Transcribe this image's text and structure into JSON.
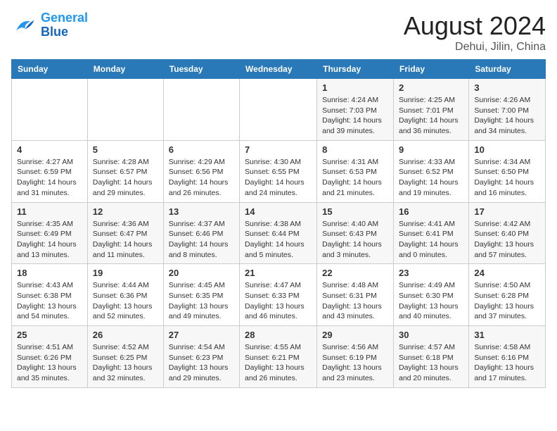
{
  "header": {
    "logo_line1": "General",
    "logo_line2": "Blue",
    "title": "August 2024",
    "location": "Dehui, Jilin, China"
  },
  "weekdays": [
    "Sunday",
    "Monday",
    "Tuesday",
    "Wednesday",
    "Thursday",
    "Friday",
    "Saturday"
  ],
  "weeks": [
    [
      {
        "day": "",
        "detail": ""
      },
      {
        "day": "",
        "detail": ""
      },
      {
        "day": "",
        "detail": ""
      },
      {
        "day": "",
        "detail": ""
      },
      {
        "day": "1",
        "detail": "Sunrise: 4:24 AM\nSunset: 7:03 PM\nDaylight: 14 hours\nand 39 minutes."
      },
      {
        "day": "2",
        "detail": "Sunrise: 4:25 AM\nSunset: 7:01 PM\nDaylight: 14 hours\nand 36 minutes."
      },
      {
        "day": "3",
        "detail": "Sunrise: 4:26 AM\nSunset: 7:00 PM\nDaylight: 14 hours\nand 34 minutes."
      }
    ],
    [
      {
        "day": "4",
        "detail": "Sunrise: 4:27 AM\nSunset: 6:59 PM\nDaylight: 14 hours\nand 31 minutes."
      },
      {
        "day": "5",
        "detail": "Sunrise: 4:28 AM\nSunset: 6:57 PM\nDaylight: 14 hours\nand 29 minutes."
      },
      {
        "day": "6",
        "detail": "Sunrise: 4:29 AM\nSunset: 6:56 PM\nDaylight: 14 hours\nand 26 minutes."
      },
      {
        "day": "7",
        "detail": "Sunrise: 4:30 AM\nSunset: 6:55 PM\nDaylight: 14 hours\nand 24 minutes."
      },
      {
        "day": "8",
        "detail": "Sunrise: 4:31 AM\nSunset: 6:53 PM\nDaylight: 14 hours\nand 21 minutes."
      },
      {
        "day": "9",
        "detail": "Sunrise: 4:33 AM\nSunset: 6:52 PM\nDaylight: 14 hours\nand 19 minutes."
      },
      {
        "day": "10",
        "detail": "Sunrise: 4:34 AM\nSunset: 6:50 PM\nDaylight: 14 hours\nand 16 minutes."
      }
    ],
    [
      {
        "day": "11",
        "detail": "Sunrise: 4:35 AM\nSunset: 6:49 PM\nDaylight: 14 hours\nand 13 minutes."
      },
      {
        "day": "12",
        "detail": "Sunrise: 4:36 AM\nSunset: 6:47 PM\nDaylight: 14 hours\nand 11 minutes."
      },
      {
        "day": "13",
        "detail": "Sunrise: 4:37 AM\nSunset: 6:46 PM\nDaylight: 14 hours\nand 8 minutes."
      },
      {
        "day": "14",
        "detail": "Sunrise: 4:38 AM\nSunset: 6:44 PM\nDaylight: 14 hours\nand 5 minutes."
      },
      {
        "day": "15",
        "detail": "Sunrise: 4:40 AM\nSunset: 6:43 PM\nDaylight: 14 hours\nand 3 minutes."
      },
      {
        "day": "16",
        "detail": "Sunrise: 4:41 AM\nSunset: 6:41 PM\nDaylight: 14 hours\nand 0 minutes."
      },
      {
        "day": "17",
        "detail": "Sunrise: 4:42 AM\nSunset: 6:40 PM\nDaylight: 13 hours\nand 57 minutes."
      }
    ],
    [
      {
        "day": "18",
        "detail": "Sunrise: 4:43 AM\nSunset: 6:38 PM\nDaylight: 13 hours\nand 54 minutes."
      },
      {
        "day": "19",
        "detail": "Sunrise: 4:44 AM\nSunset: 6:36 PM\nDaylight: 13 hours\nand 52 minutes."
      },
      {
        "day": "20",
        "detail": "Sunrise: 4:45 AM\nSunset: 6:35 PM\nDaylight: 13 hours\nand 49 minutes."
      },
      {
        "day": "21",
        "detail": "Sunrise: 4:47 AM\nSunset: 6:33 PM\nDaylight: 13 hours\nand 46 minutes."
      },
      {
        "day": "22",
        "detail": "Sunrise: 4:48 AM\nSunset: 6:31 PM\nDaylight: 13 hours\nand 43 minutes."
      },
      {
        "day": "23",
        "detail": "Sunrise: 4:49 AM\nSunset: 6:30 PM\nDaylight: 13 hours\nand 40 minutes."
      },
      {
        "day": "24",
        "detail": "Sunrise: 4:50 AM\nSunset: 6:28 PM\nDaylight: 13 hours\nand 37 minutes."
      }
    ],
    [
      {
        "day": "25",
        "detail": "Sunrise: 4:51 AM\nSunset: 6:26 PM\nDaylight: 13 hours\nand 35 minutes."
      },
      {
        "day": "26",
        "detail": "Sunrise: 4:52 AM\nSunset: 6:25 PM\nDaylight: 13 hours\nand 32 minutes."
      },
      {
        "day": "27",
        "detail": "Sunrise: 4:54 AM\nSunset: 6:23 PM\nDaylight: 13 hours\nand 29 minutes."
      },
      {
        "day": "28",
        "detail": "Sunrise: 4:55 AM\nSunset: 6:21 PM\nDaylight: 13 hours\nand 26 minutes."
      },
      {
        "day": "29",
        "detail": "Sunrise: 4:56 AM\nSunset: 6:19 PM\nDaylight: 13 hours\nand 23 minutes."
      },
      {
        "day": "30",
        "detail": "Sunrise: 4:57 AM\nSunset: 6:18 PM\nDaylight: 13 hours\nand 20 minutes."
      },
      {
        "day": "31",
        "detail": "Sunrise: 4:58 AM\nSunset: 6:16 PM\nDaylight: 13 hours\nand 17 minutes."
      }
    ]
  ]
}
